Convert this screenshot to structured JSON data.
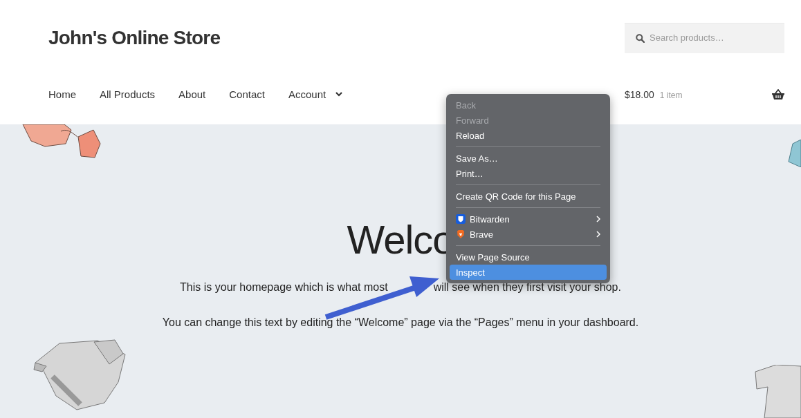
{
  "site_title": "John's Online Store",
  "search": {
    "placeholder": "Search products…"
  },
  "nav": [
    {
      "label": "Home",
      "dropdown": false
    },
    {
      "label": "All Products",
      "dropdown": false
    },
    {
      "label": "About",
      "dropdown": false
    },
    {
      "label": "Contact",
      "dropdown": false
    },
    {
      "label": "Account",
      "dropdown": true
    }
  ],
  "cart": {
    "total": "$18.00",
    "count": "1 item"
  },
  "hero": {
    "heading": "Welco",
    "paragraphs": [
      [
        "This is your homepage which is what most",
        "will see when they first visit your shop."
      ],
      [
        "You can change this text by editing the “Welcome” page via the “Pages” menu in your dashboard."
      ]
    ]
  },
  "context_menu": [
    {
      "kind": "item",
      "label": "Back",
      "disabled": true,
      "selected": false
    },
    {
      "kind": "item",
      "label": "Forward",
      "disabled": true,
      "selected": false
    },
    {
      "kind": "item",
      "label": "Reload",
      "disabled": false,
      "selected": false
    },
    {
      "kind": "separator"
    },
    {
      "kind": "item",
      "label": "Save As…",
      "disabled": false,
      "selected": false
    },
    {
      "kind": "item",
      "label": "Print…",
      "disabled": false,
      "selected": false
    },
    {
      "kind": "separator"
    },
    {
      "kind": "item",
      "label": "Create QR Code for this Page",
      "disabled": false,
      "selected": false
    },
    {
      "kind": "separator"
    },
    {
      "kind": "extension",
      "label": "Bitwarden",
      "disabled": false,
      "selected": false,
      "submenu": true
    },
    {
      "kind": "extension",
      "label": "Brave",
      "disabled": false,
      "selected": false,
      "submenu": true
    },
    {
      "kind": "separator"
    },
    {
      "kind": "item",
      "label": "View Page Source",
      "disabled": false,
      "selected": false
    },
    {
      "kind": "item",
      "label": "Inspect",
      "disabled": false,
      "selected": true
    }
  ]
}
